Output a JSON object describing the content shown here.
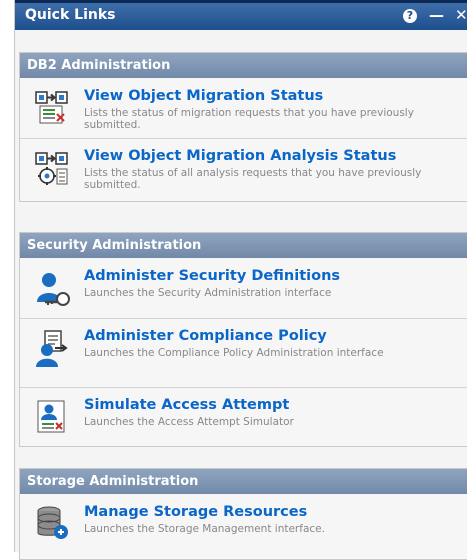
{
  "window": {
    "title": "Quick Links",
    "help_glyph": "?",
    "minimize_glyph": "—",
    "close_glyph": "✕"
  },
  "sections": [
    {
      "heading": "DB2 Administration",
      "items": [
        {
          "title": "View Object Migration Status",
          "desc": "Lists the status of migration requests that you have previously submitted.",
          "icon": "migration-status-icon"
        },
        {
          "title": "View Object Migration Analysis Status",
          "desc": "Lists the status of all analysis requests that you have previously submitted.",
          "icon": "migration-analysis-icon"
        }
      ]
    },
    {
      "heading": "Security Administration",
      "items": [
        {
          "title": "Administer Security Definitions",
          "desc": "Launches the Security Administration interface",
          "icon": "user-key-icon"
        },
        {
          "title": "Administer Compliance Policy",
          "desc": "Launches the Compliance Policy Administration interface",
          "icon": "user-policy-icon"
        },
        {
          "title": "Simulate Access Attempt",
          "desc": "Launches the Access Attempt Simulator",
          "icon": "access-simulator-icon"
        }
      ]
    },
    {
      "heading": "Storage Administration",
      "items": [
        {
          "title": "Manage Storage Resources",
          "desc": "Launches the Storage Management interface.",
          "icon": "storage-database-icon"
        }
      ]
    }
  ],
  "colors": {
    "titlebar": "#1d4f8d",
    "section_header": "#7f96b4",
    "link": "#0a66c8",
    "desc": "#888888"
  }
}
